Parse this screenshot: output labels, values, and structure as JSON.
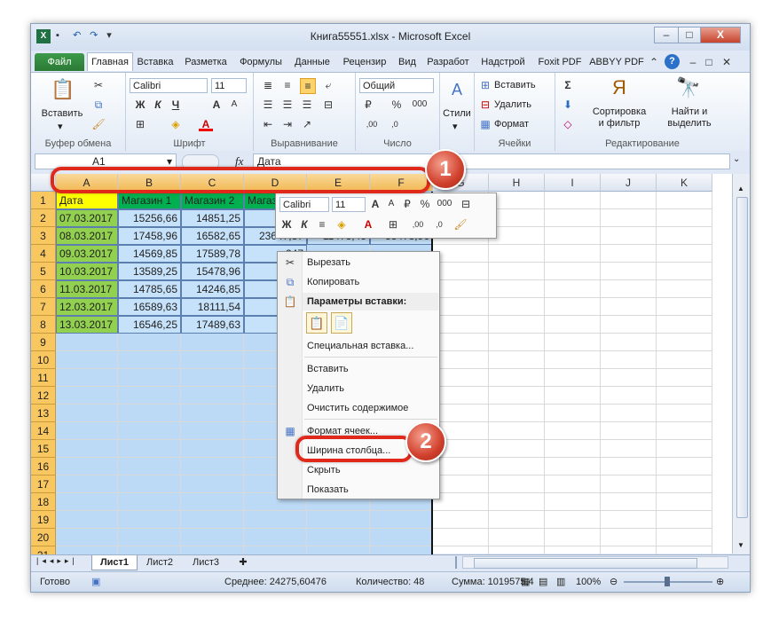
{
  "window": {
    "title": "Книга55551.xlsx - Microsoft Excel",
    "buttons": {
      "minimize": "–",
      "restore": "□",
      "close": "X"
    }
  },
  "ribbon_tabs": [
    {
      "label": "Файл",
      "kind": "file"
    },
    {
      "label": "Главная",
      "kind": "active"
    },
    {
      "label": "Вставка"
    },
    {
      "label": "Разметка"
    },
    {
      "label": "Формулы"
    },
    {
      "label": "Данные"
    },
    {
      "label": "Рецензир"
    },
    {
      "label": "Вид"
    },
    {
      "label": "Разработ"
    },
    {
      "label": "Надстрой"
    },
    {
      "label": "Foxit PDF"
    },
    {
      "label": "ABBYY PDF"
    }
  ],
  "ribbon": {
    "clipboard": {
      "paste": "Вставить",
      "group": "Буфер обмена"
    },
    "font": {
      "name": "Calibri",
      "size": "11",
      "bold": "Ж",
      "italic": "К",
      "underline": "Ч",
      "grow": "A",
      "shrink": "A",
      "color": "A",
      "group": "Шрифт"
    },
    "alignment": {
      "group": "Выравнивание"
    },
    "number": {
      "format": "Общий",
      "percent": "%",
      "thousands": "000",
      "group": "Число"
    },
    "styles": {
      "label": "Стили"
    },
    "cells": {
      "insert": "Вставить",
      "delete": "Удалить",
      "format": "Формат",
      "group": "Ячейки"
    },
    "editing": {
      "sum": "Σ",
      "sort": "Сортировка",
      "sort2": "и фильтр",
      "find": "Найти и",
      "find2": "выделить",
      "group": "Редактирование"
    }
  },
  "formula_bar": {
    "name_box": "A1",
    "fx": "fx",
    "value": "Дата"
  },
  "columns": [
    "A",
    "B",
    "C",
    "D",
    "E",
    "F",
    "G",
    "H",
    "I",
    "J",
    "K"
  ],
  "rows": [
    "1",
    "2",
    "3",
    "4",
    "5",
    "6",
    "7",
    "8",
    "9",
    "10",
    "11",
    "12",
    "13",
    "14",
    "15",
    "16",
    "17",
    "18",
    "19",
    "20",
    "21"
  ],
  "table": {
    "headers": [
      "Дата",
      "Магазин 1",
      "Магазин 2",
      "Магазин 3"
    ],
    "data": [
      [
        "07.03.2017",
        "15256,66",
        "14851,25",
        "258"
      ],
      [
        "08.03.2017",
        "17458,96",
        "16582,65",
        "23647,87",
        "11478,45",
        "33478,96"
      ],
      [
        "09.03.2017",
        "14569,85",
        "17589,78",
        "247"
      ],
      [
        "10.03.2017",
        "13589,25",
        "15478,96",
        "242"
      ],
      [
        "11.03.2017",
        "14785,65",
        "14246,85",
        "224"
      ],
      [
        "12.03.2017",
        "16589,63",
        "18111,54",
        "268"
      ],
      [
        "13.03.2017",
        "16546,25",
        "17489,63",
        "255"
      ]
    ]
  },
  "mini_toolbar": {
    "font": "Calibri",
    "size": "11",
    "bold": "Ж",
    "italic": "К",
    "percent": "%",
    "thousands": "000"
  },
  "context_menu": {
    "cut": "Вырезать",
    "copy": "Копировать",
    "paste_options": "Параметры вставки:",
    "paste_special": "Специальная вставка...",
    "insert": "Вставить",
    "delete": "Удалить",
    "clear": "Очистить содержимое",
    "format_cells": "Формат ячеек...",
    "column_width": "Ширина столбца...",
    "hide": "Скрыть",
    "show": "Показать"
  },
  "sheets": [
    "Лист1",
    "Лист2",
    "Лист3"
  ],
  "status_bar": {
    "ready": "Готово",
    "average": "Среднее: 24275,60476",
    "count": "Количество: 48",
    "sum": "Сумма: 1019575,4",
    "zoom": "100%"
  },
  "callouts": [
    "1",
    "2"
  ],
  "colors": {
    "date_cells": "#92d050",
    "store_header": "#00b050",
    "data_cells": "#c6e2fa",
    "selection": "#bcd9f5",
    "row_header": "#f9c75f",
    "callout_red": "#e0281b"
  }
}
